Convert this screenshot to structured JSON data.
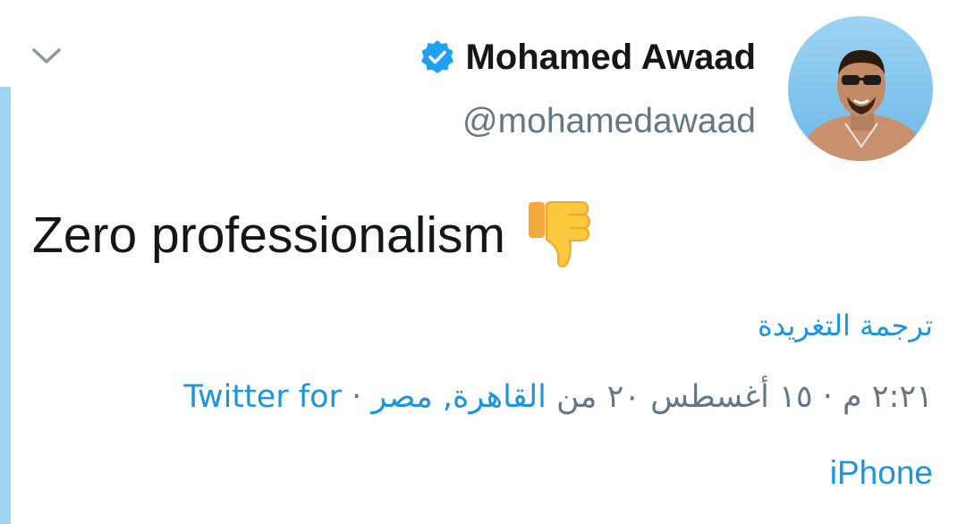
{
  "header": {
    "display_name": "Mohamed Awaad",
    "handle": "@mohamedawaad",
    "verified": true,
    "verified_icon": "verified-badge-icon",
    "menu_icon": "chevron-down-icon",
    "avatar": "profile-photo"
  },
  "tweet": {
    "text": "Zero professionalism",
    "emoji": "👎",
    "emoji_icon": "thumbs-down-icon"
  },
  "translate_label": "ترجمة التغريدة",
  "meta": {
    "timestamp": "٢:٢١ م · ١٥ أغسطس ٢٠",
    "from_label": "من",
    "location": "القاهرة, مصر",
    "separator": "·",
    "client_part1": "Twitter for",
    "client_part2": "iPhone"
  },
  "colors": {
    "link": "#1b95e0",
    "secondary_text": "#657786",
    "primary_text": "#14171a",
    "thread_bar": "#9fd4f5",
    "verified_badge": "#1da1f2"
  }
}
